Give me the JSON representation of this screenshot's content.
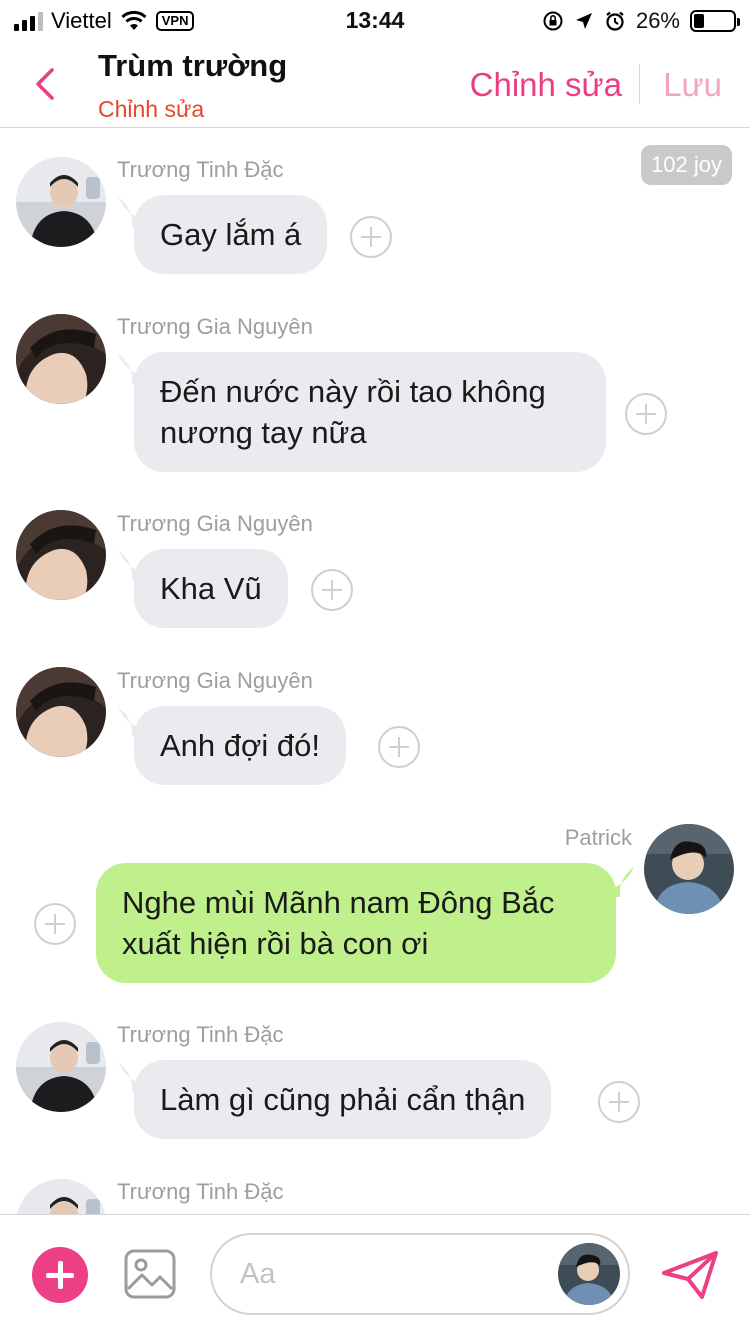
{
  "status_bar": {
    "carrier": "Viettel",
    "vpn": "VPN",
    "time": "13:44",
    "battery": "26%",
    "battery_level": 0.26
  },
  "header": {
    "title": "Trùm trường",
    "subtitle": "Chỉnh sửa",
    "edit_label": "Chỉnh sửa",
    "save_label": "Lưu",
    "accent_color": "#ea3d84"
  },
  "joy_badge": "102 joy",
  "messages": [
    {
      "sender": "Trương Tinh Đặc",
      "text": "Gay lắm á",
      "side": "in"
    },
    {
      "sender": "Trương Gia Nguyên",
      "text": "Đến nước này rồi tao không nương tay nữa",
      "side": "in"
    },
    {
      "sender": "Trương Gia Nguyên",
      "text": "Kha Vũ",
      "side": "in"
    },
    {
      "sender": "Trương Gia Nguyên",
      "text": "Anh đợi đó!",
      "side": "in"
    },
    {
      "sender": "Patrick",
      "text": "Nghe mùi Mãnh nam Đông Bắc xuất hiện rồi bà con ơi",
      "side": "out"
    },
    {
      "sender": "Trương Tinh Đặc",
      "text": "Làm gì cũng phải cẩn thận",
      "side": "in"
    },
    {
      "sender": "Trương Tinh Đặc",
      "text": "",
      "side": "in"
    }
  ],
  "composer": {
    "placeholder": "Aa",
    "value": ""
  },
  "icons": {
    "back": "chevron-left-icon",
    "add": "plus-icon",
    "image": "image-icon",
    "send": "send-icon"
  },
  "colors": {
    "incoming_bubble": "#e9ebee",
    "outgoing_bubble": "#bff08b",
    "subtitle": "#e8452c"
  }
}
